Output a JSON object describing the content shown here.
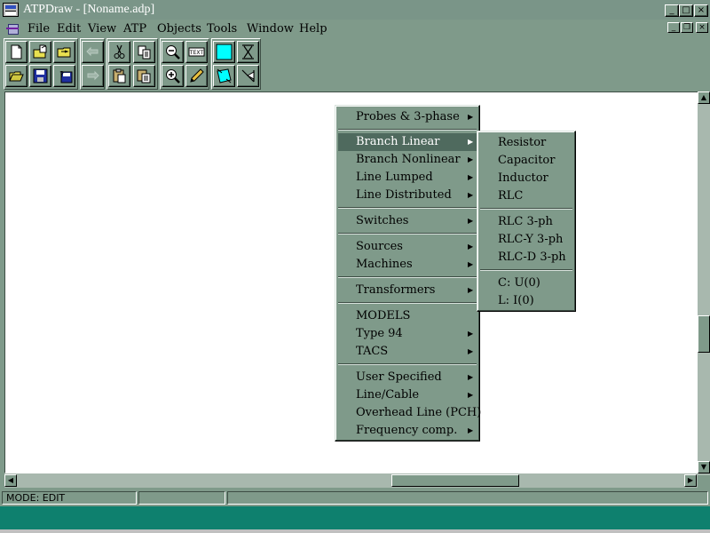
{
  "window": {
    "title": "ATPDraw - [Noname.adp]"
  },
  "caption_buttons": {
    "minimize": "_",
    "maximize": "□",
    "close": "×"
  },
  "mdi_buttons": {
    "minimize": "_",
    "restore": "❐",
    "close": "×"
  },
  "menubar": {
    "items": [
      "File",
      "Edit",
      "View",
      "ATP",
      "Objects",
      "Tools",
      "Window",
      "Help"
    ]
  },
  "toolbar": {
    "row1": [
      "new-icon",
      "open-multi-icon",
      "import-icon",
      "undo-icon",
      "cut-icon",
      "copy-icon",
      "zoom-out-icon",
      "text-icon",
      "fill-icon",
      "transformer-icon"
    ],
    "row2": [
      "open-icon",
      "save-icon",
      "save-as-icon",
      "redo-icon",
      "paste-icon",
      "paste-group-icon",
      "zoom-in-icon",
      "pencil-icon",
      "rotate-icon",
      "flip-icon"
    ],
    "text_icon_label": "TEXT",
    "fill_color": "#00ffff"
  },
  "statusbar": {
    "mode": "MODE: EDIT",
    "pane2": "",
    "pane3": ""
  },
  "colors": {
    "face": "#7f9a8a",
    "selected": "#4f6a5e",
    "taskbar": "#0e806e"
  },
  "components_menu": {
    "items": [
      {
        "label": "Probes & 3-phase",
        "submenu": true
      },
      {
        "separator": true
      },
      {
        "label": "Branch Linear",
        "submenu": true,
        "selected": true
      },
      {
        "label": "Branch Nonlinear",
        "submenu": true
      },
      {
        "label": "Line Lumped",
        "submenu": true
      },
      {
        "label": "Line Distributed",
        "submenu": true
      },
      {
        "separator": true
      },
      {
        "label": "Switches",
        "submenu": true
      },
      {
        "separator": true
      },
      {
        "label": "Sources",
        "submenu": true
      },
      {
        "label": "Machines",
        "submenu": true
      },
      {
        "separator": true
      },
      {
        "label": "Transformers",
        "submenu": true
      },
      {
        "separator": true
      },
      {
        "label": "MODELS",
        "submenu": false
      },
      {
        "label": "Type 94",
        "submenu": true
      },
      {
        "label": "TACS",
        "submenu": true
      },
      {
        "separator": true
      },
      {
        "label": "User Specified",
        "submenu": true
      },
      {
        "label": "Line/Cable",
        "submenu": true
      },
      {
        "label": "Overhead Line (PCH)",
        "submenu": false
      },
      {
        "label": "Frequency comp.",
        "submenu": true
      }
    ]
  },
  "branch_linear_submenu": {
    "items": [
      {
        "label": "Resistor"
      },
      {
        "label": "Capacitor"
      },
      {
        "label": "Inductor"
      },
      {
        "label": "RLC"
      },
      {
        "separator": true
      },
      {
        "label": "RLC 3-ph"
      },
      {
        "label": "RLC-Y 3-ph"
      },
      {
        "label": "RLC-D 3-ph"
      },
      {
        "separator": true
      },
      {
        "label": "C: U(0)"
      },
      {
        "label": "L: I(0)"
      }
    ]
  }
}
